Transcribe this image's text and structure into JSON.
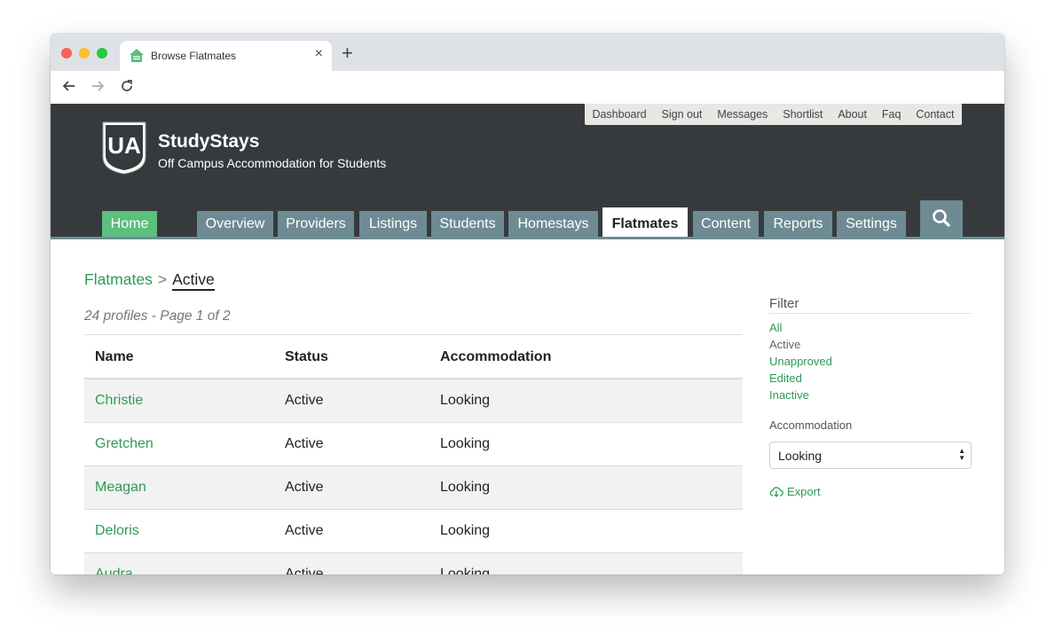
{
  "browser": {
    "tab_title": "Browse Flatmates",
    "new_tab": "+",
    "close": "×"
  },
  "header": {
    "utility_links": [
      "Dashboard",
      "Sign out",
      "Messages",
      "Shortlist",
      "About",
      "Faq",
      "Contact"
    ],
    "logo_text": "UA",
    "title": "StudyStays",
    "subtitle": "Off Campus Accommodation for Students",
    "nav": [
      "Home",
      "Overview",
      "Providers",
      "Listings",
      "Students",
      "Homestays",
      "Flatmates",
      "Content",
      "Reports",
      "Settings"
    ],
    "active_nav": "Flatmates"
  },
  "main": {
    "breadcrumb": {
      "parent": "Flatmates",
      "separator": ">",
      "current": "Active"
    },
    "summary": "24 profiles - Page 1 of 2",
    "table": {
      "columns": [
        "Name",
        "Status",
        "Accommodation"
      ],
      "rows": [
        [
          "Christie",
          "Active",
          "Looking"
        ],
        [
          "Gretchen",
          "Active",
          "Looking"
        ],
        [
          "Meagan",
          "Active",
          "Looking"
        ],
        [
          "Deloris",
          "Active",
          "Looking"
        ],
        [
          "Audra",
          "Active",
          "Looking"
        ]
      ]
    }
  },
  "filter": {
    "title": "Filter",
    "links": [
      "All",
      "Active",
      "Unapproved",
      "Edited",
      "Inactive"
    ],
    "current": "Active",
    "accommodation_label": "Accommodation",
    "accommodation_value": "Looking",
    "export_label": "Export"
  },
  "colors": {
    "accent_green": "#2e9a55",
    "header_bg": "#373a3c",
    "nav_bg": "#6e8b94",
    "home_bg": "#5cbf7d"
  },
  "icons": [
    "back-icon",
    "forward-icon",
    "reload-icon",
    "search-icon",
    "cloud-download-icon",
    "favicon-house-icon"
  ]
}
